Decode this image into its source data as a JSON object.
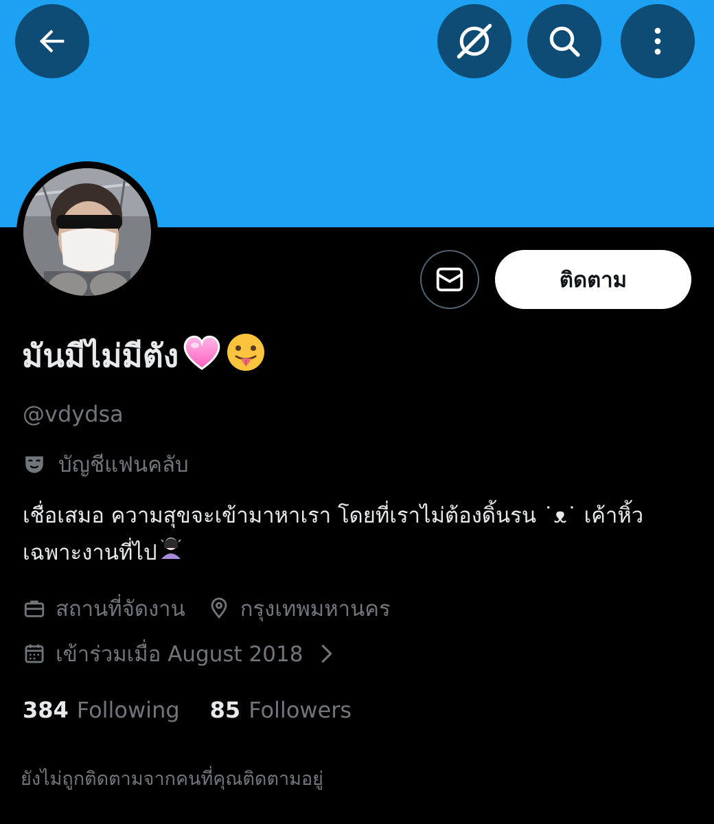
{
  "header": {
    "back_icon": "arrow-left-icon",
    "explore_icon": "compass-slash-icon",
    "search_icon": "search-icon",
    "more_icon": "more-vertical-icon",
    "banner_color": "#1da1f2",
    "button_color": "#0f4c75"
  },
  "profile": {
    "display_name": "มันมีไม่มีตัง",
    "display_name_emojis": [
      "pink-heart-emoji",
      "tongue-out-emoji"
    ],
    "handle": "@vdydsa",
    "category": "บัญชีแฟนคลับ",
    "bio_line1": "เชื่อเสมอ ความสุขจะเข้ามาหาเรา โดยที่เราไม่ต้องดิ้นรน ˙ᴥ˙ เค้าหิ้ว",
    "bio_line2": "เฉพาะงานที่ไป",
    "location_label": "สถานที่จัดงาน",
    "city": "กรุงเทพมหานคร",
    "joined": "เข้าร่วมเมื่อ August 2018"
  },
  "actions": {
    "message_icon": "mail-icon",
    "follow_label": "ติดตาม"
  },
  "stats": {
    "following_count": "384",
    "following_label": "Following",
    "followers_count": "85",
    "followers_label": "Followers"
  },
  "footer": {
    "not_followed_text": "ยังไม่ถูกติดตามจากคนที่คุณติดตามอยู่"
  }
}
